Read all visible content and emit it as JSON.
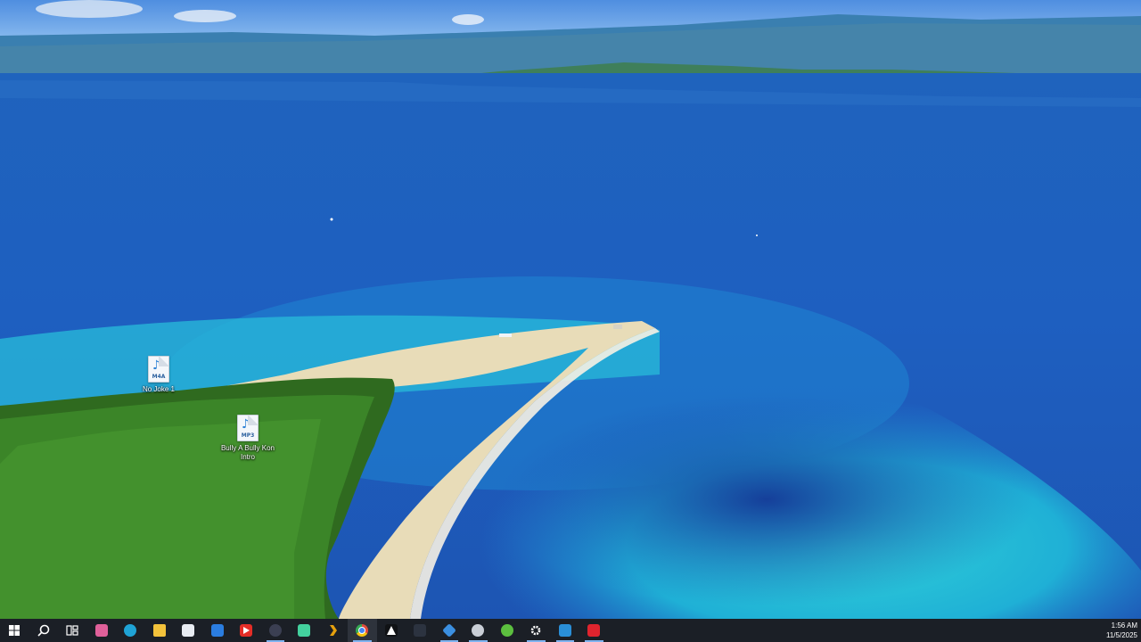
{
  "desktop": {
    "icons": [
      {
        "ext": "M4A",
        "label": "No Joke 1"
      },
      {
        "ext": "MP3",
        "label": "Bully A Bully Kon Intro"
      }
    ]
  },
  "taskbar": {
    "icons": [
      {
        "name": "start-icon",
        "color": "#ffffff"
      },
      {
        "name": "search-icon",
        "color": "#ffffff"
      },
      {
        "name": "task-view-icon",
        "color": "#ffffff"
      },
      {
        "name": "copilot-icon",
        "color": "#e0609a"
      },
      {
        "name": "edge-icon",
        "color": "#1fa3d6"
      },
      {
        "name": "file-explorer-icon",
        "color": "#f3c23b"
      },
      {
        "name": "microsoft-store-icon",
        "color": "#e8ecf2"
      },
      {
        "name": "mail-icon",
        "color": "#2b7de0"
      },
      {
        "name": "youtube-icon",
        "color": "#e52d27"
      },
      {
        "name": "media-app-icon",
        "color": "#3b3f52"
      },
      {
        "name": "android-app-icon",
        "color": "#43d19e"
      },
      {
        "name": "plex-icon",
        "color": "#e5a00d"
      },
      {
        "name": "chrome-icon",
        "color": "#e04a3c"
      },
      {
        "name": "triangle-app-icon",
        "color": "#101215"
      },
      {
        "name": "audio-editor-icon",
        "color": "#2c3340"
      },
      {
        "name": "diamond-app-icon",
        "color": "#3b8fe0"
      },
      {
        "name": "globe-app-icon",
        "color": "#c9ced6"
      },
      {
        "name": "green-app-icon",
        "color": "#5cbf3f"
      },
      {
        "name": "settings-icon",
        "color": "#ffffff"
      },
      {
        "name": "video-editor-icon",
        "color": "#2a8fd8"
      },
      {
        "name": "red-app-icon",
        "color": "#e0242e"
      }
    ],
    "active_index": 12,
    "running_indices": [
      9,
      12,
      15,
      16,
      18,
      19,
      20
    ]
  },
  "tray": {
    "time": "1:56 AM",
    "date": "11/5/2025"
  }
}
